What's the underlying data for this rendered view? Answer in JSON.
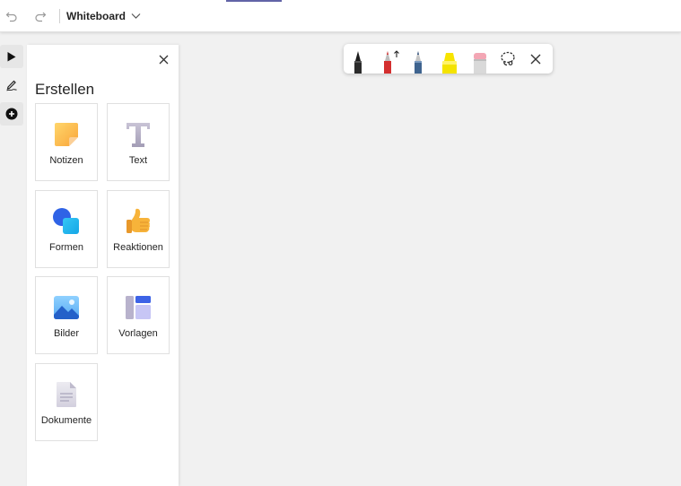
{
  "topbar": {
    "title": "Whiteboard"
  },
  "panel": {
    "title": "Erstellen",
    "items": [
      {
        "label": "Notizen",
        "icon": "sticky-note-icon"
      },
      {
        "label": "Text",
        "icon": "text-icon"
      },
      {
        "label": "Formen",
        "icon": "shapes-icon"
      },
      {
        "label": "Reaktionen",
        "icon": "thumbs-up-icon"
      },
      {
        "label": "Bilder",
        "icon": "image-icon"
      },
      {
        "label": "Vorlagen",
        "icon": "template-icon"
      },
      {
        "label": "Dokumente",
        "icon": "document-icon"
      }
    ]
  },
  "pen_toolbar": {
    "tools": [
      "black-pen-icon",
      "red-arrow-pen-icon",
      "blue-pen-icon",
      "yellow-highlighter-icon",
      "eraser-icon",
      "lasso-icon",
      "close-icon"
    ]
  },
  "colors": {
    "accent": "#6264a7",
    "canvas": "#f1f1f1"
  }
}
